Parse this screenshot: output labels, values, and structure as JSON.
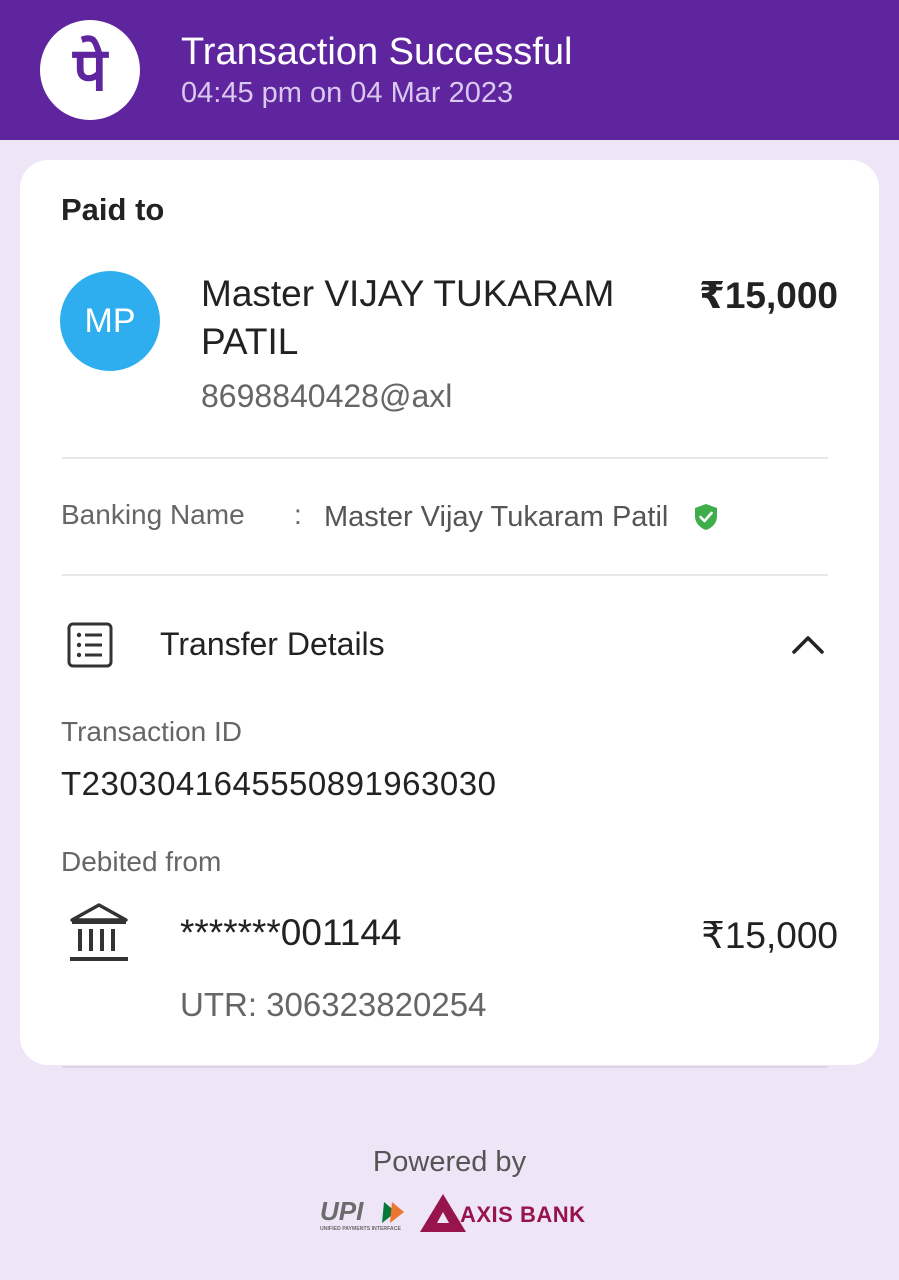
{
  "header": {
    "logo_glyph": "पे",
    "title": "Transaction Successful",
    "subtitle": "04:45 pm on 04 Mar 2023"
  },
  "paid_to": {
    "label": "Paid to",
    "avatar_initials": "MP",
    "name": "Master VIJAY TUKARAM PATIL",
    "upi_id": "8698840428@axl",
    "amount": "₹15,000"
  },
  "banking_name": {
    "label": "Banking Name",
    "separator": ":",
    "value": "Master Vijay Tukaram Patil",
    "verified_icon": "shield-check-icon"
  },
  "transfer_details": {
    "icon": "receipt-list-icon",
    "title": "Transfer Details",
    "toggle_icon": "chevron-up-icon",
    "transaction_id_label": "Transaction ID",
    "transaction_id": "T2303041645550891963030",
    "debited_from_label": "Debited from",
    "bank_icon": "bank-icon",
    "account": "*******001144",
    "debited_amount": "₹15,000",
    "utr": "UTR: 306323820254"
  },
  "footer": {
    "powered_by": "Powered by",
    "upi_logo_text": "UPI",
    "upi_tagline": "UNIFIED PAYMENTS INTERFACE",
    "bank_name": "AXIS BANK"
  },
  "colors": {
    "brand_purple": "#5F259F",
    "background": "#EEE5F7",
    "avatar_blue": "#2FAEEF",
    "verified_green": "#3FAE4A",
    "axis_maroon": "#97144D"
  }
}
